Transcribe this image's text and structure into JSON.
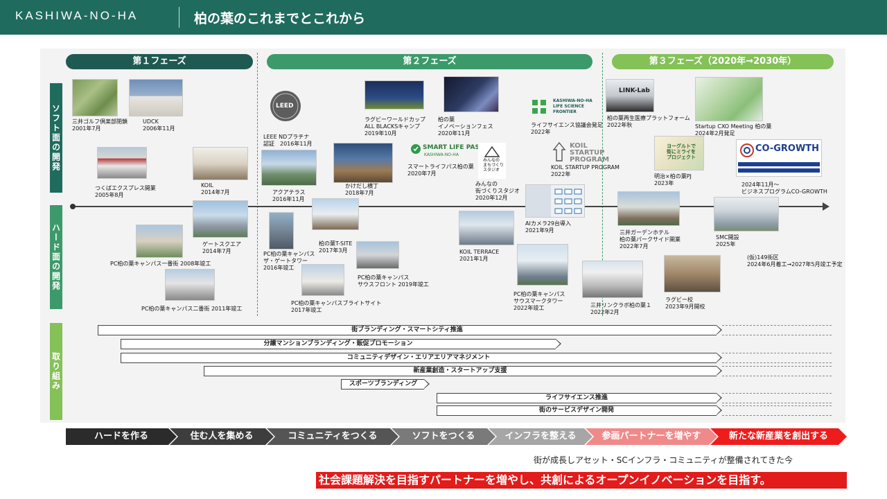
{
  "header": {
    "brand": "KASHIWA-NO-HA",
    "title": "柏の葉のこれまでとこれから"
  },
  "phases": [
    {
      "label": "第１フェーズ"
    },
    {
      "label": "第２フェーズ"
    },
    {
      "label": "第３フェーズ（2020年→2030年）"
    }
  ],
  "rows": {
    "soft": "ソフト面の開発",
    "hard": "ハード面の開発",
    "tori": "取り組み"
  },
  "milestones": [
    {
      "label": "三井ゴルフ倶楽部閉鎖\n2001年7月"
    },
    {
      "label": "UDCK\n2006年11月"
    },
    {
      "label": "つくばエクスプレス開業\n2005年8月"
    },
    {
      "label": "KOIL\n2014年7月"
    },
    {
      "label": "LEEE NDプラチナ\n認証　2016年11月"
    },
    {
      "label": "アクアテラス\n2016年11月"
    },
    {
      "label": "かけだし横丁\n2018年7月"
    },
    {
      "label": "ラグビーワールドカップ\nALL BLACKSキャンプ\n2019年10月"
    },
    {
      "label": "柏の葉\nイノベーションフェス\n2020年11月"
    },
    {
      "label": "スマートライフパス柏の葉\n2020年7月"
    },
    {
      "label": "みんなの\n街づくりスタジオ\n2020年12月"
    },
    {
      "label": "ライフサイエンス協議会発足\n2022年"
    },
    {
      "label": "KOIL STARTUP PROGRAM\n2022年"
    },
    {
      "label": "柏の葉再生医療プラットフォーム\n2022年秋"
    },
    {
      "label": "Startup CXO Meeting 柏の葉\n2024年2月発足"
    },
    {
      "label": "明治×柏の葉PJ\n2023年"
    },
    {
      "label": "2024年11月～\nビジネスプログラムCO-GROWTH"
    },
    {
      "label": "ゲートスクエア\n2014年7月"
    },
    {
      "label": "PC柏の葉キャンパス一番街 2008年竣工"
    },
    {
      "label": "PC柏の葉キャンパス二番街 2011年竣工"
    },
    {
      "label": "PC柏の葉キャンパス\nザ・ゲートタワー\n2016年竣工"
    },
    {
      "label": "柏の葉T-SITE\n2017年3月"
    },
    {
      "label": "PC柏の葉キャンパス\nサウスフロント 2019年竣工"
    },
    {
      "label": "PC柏の葉キャンパスブライトサイト\n2017年竣工"
    },
    {
      "label": "KOIL TERRACE\n2021年1月"
    },
    {
      "label": "AIカメラ29台導入\n2021年9月"
    },
    {
      "label": "PC柏の葉キャンパス\nサウスマークタワー\n2022年竣工"
    },
    {
      "label": "三井リンクラボ柏の葉１\n2022年2月"
    },
    {
      "label": "三井ガーデンホテル\n柏の葉パークサイド開業\n2022年7月"
    },
    {
      "label": "ラグビー校\n2023年9月開校"
    },
    {
      "label": "SMC開設\n2025年"
    },
    {
      "label": "(仮)149街区\n2024年6月着工→2027年5月竣工予定"
    }
  ],
  "logos": {
    "leed": "LEED",
    "smart_life_pass": "SMART LIFE PASS",
    "smart_life_sub": "KASHIWA-NO-HA",
    "lsf": "KASHIWA-NO-HA\nLIFE SCIENCE\nFRONTIER",
    "koil": "KOIL\nSTARTUP\nPROGRAM",
    "cogrowth": "CO-GROWTH",
    "linklab": "LINK-Lab",
    "yogurt": "ヨーグルトで\n街にミライを\nプロジェクト",
    "studio": "みんなの\nまちづくり\nスタジオ"
  },
  "initiatives": [
    {
      "label": "街ブランディング・スマートシティ推進"
    },
    {
      "label": "分譲マンションブランディング・販促プロモーション"
    },
    {
      "label": "コミュニティデザイン・エリアエリアマネジメント"
    },
    {
      "label": "新産業創造・スタートアップ支援"
    },
    {
      "label": "スポーツブランディング"
    },
    {
      "label": "ライフサイエンス推進"
    },
    {
      "label": "街のサービスデザイン開発"
    }
  ],
  "steps": [
    {
      "label": "ハードを作る",
      "color": "#2b2b2b"
    },
    {
      "label": "住む人を集める",
      "color": "#3d3d3d"
    },
    {
      "label": "コミュニティをつくる",
      "color": "#555555"
    },
    {
      "label": "ソフトをつくる",
      "color": "#7a7a7a"
    },
    {
      "label": "インフラを整える",
      "color": "#a6a6a6"
    },
    {
      "label": "参画パートナーを増やす",
      "color": "#f08a8a"
    },
    {
      "label": "新たな新産業を創出する",
      "color": "#ef1c1c"
    }
  ],
  "caption": "街が成長しアセット・SCインフラ・コミュニティが整備されてきた今",
  "banner": "社会課題解決を目指すパートナーを増やし、共創によるオープンイノベーションを目指す。"
}
